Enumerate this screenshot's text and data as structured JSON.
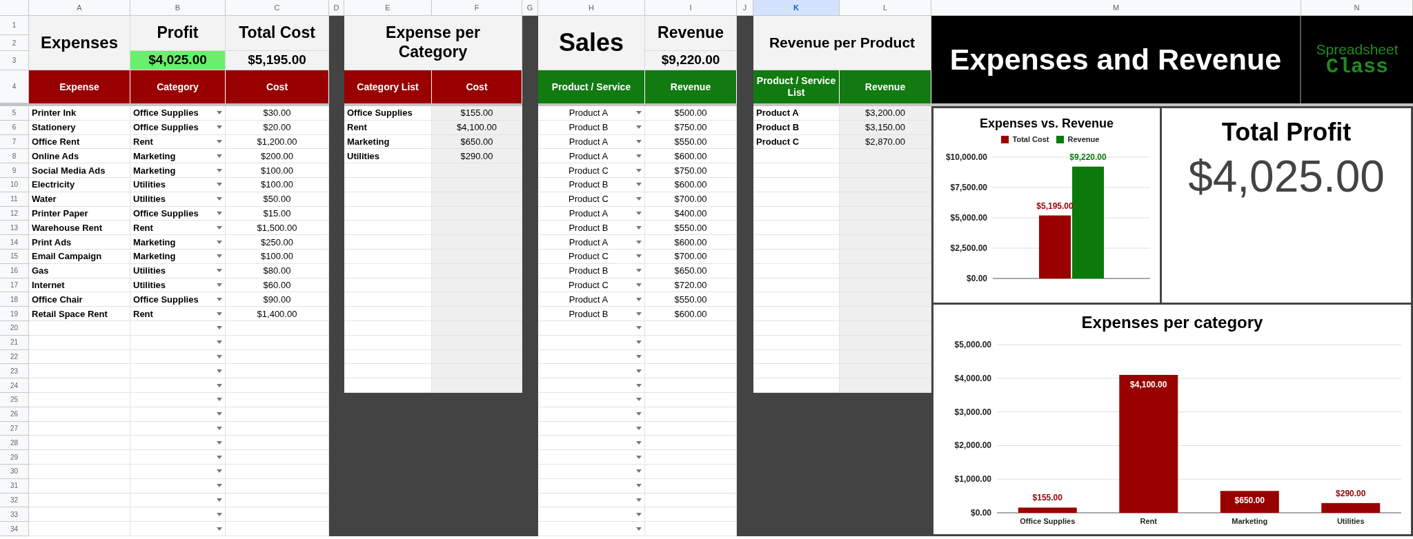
{
  "column_headers": [
    {
      "label": "A",
      "selected": false
    },
    {
      "label": "B",
      "selected": false
    },
    {
      "label": "C",
      "selected": false
    },
    {
      "label": "D",
      "selected": false
    },
    {
      "label": "E",
      "selected": false
    },
    {
      "label": "F",
      "selected": false
    },
    {
      "label": "G",
      "selected": false
    },
    {
      "label": "H",
      "selected": false
    },
    {
      "label": "I",
      "selected": false
    },
    {
      "label": "J",
      "selected": false
    },
    {
      "label": "K",
      "selected": true
    },
    {
      "label": "L",
      "selected": false
    },
    {
      "label": "M",
      "selected": false
    },
    {
      "label": "N",
      "selected": false
    }
  ],
  "row_numbers": [
    "1",
    "2",
    "3",
    "4",
    "5",
    "6",
    "7",
    "8",
    "9",
    "10",
    "11",
    "12",
    "13",
    "14",
    "15",
    "16",
    "17",
    "18",
    "19",
    "20",
    "21",
    "22",
    "23",
    "24",
    "25",
    "26",
    "27",
    "28",
    "29",
    "30",
    "31",
    "32",
    "33",
    "34"
  ],
  "expenses": {
    "title": "Expenses",
    "profit_label": "Profit",
    "profit_value": "$4,025.00",
    "total_cost_label": "Total Cost",
    "total_cost_value": "$5,195.00",
    "columns": [
      "Expense",
      "Category",
      "Cost"
    ],
    "rows": [
      {
        "expense": "Printer Ink",
        "category": "Office Supplies",
        "cost": "$30.00"
      },
      {
        "expense": "Stationery",
        "category": "Office Supplies",
        "cost": "$20.00"
      },
      {
        "expense": "Office Rent",
        "category": "Rent",
        "cost": "$1,200.00"
      },
      {
        "expense": "Online Ads",
        "category": "Marketing",
        "cost": "$200.00"
      },
      {
        "expense": "Social Media Ads",
        "category": "Marketing",
        "cost": "$100.00"
      },
      {
        "expense": "Electricity",
        "category": "Utilities",
        "cost": "$100.00"
      },
      {
        "expense": "Water",
        "category": "Utilities",
        "cost": "$50.00"
      },
      {
        "expense": "Printer Paper",
        "category": "Office Supplies",
        "cost": "$15.00"
      },
      {
        "expense": "Warehouse Rent",
        "category": "Rent",
        "cost": "$1,500.00"
      },
      {
        "expense": "Print Ads",
        "category": "Marketing",
        "cost": "$250.00"
      },
      {
        "expense": "Email Campaign",
        "category": "Marketing",
        "cost": "$100.00"
      },
      {
        "expense": "Gas",
        "category": "Utilities",
        "cost": "$80.00"
      },
      {
        "expense": "Internet",
        "category": "Utilities",
        "cost": "$60.00"
      },
      {
        "expense": "Office Chair",
        "category": "Office Supplies",
        "cost": "$90.00"
      },
      {
        "expense": "Retail Space Rent",
        "category": "Rent",
        "cost": "$1,400.00"
      }
    ]
  },
  "expense_per_category": {
    "title": "Expense per Category",
    "columns": [
      "Category List",
      "Cost"
    ],
    "rows": [
      {
        "category": "Office Supplies",
        "cost": "$155.00"
      },
      {
        "category": "Rent",
        "cost": "$4,100.00"
      },
      {
        "category": "Marketing",
        "cost": "$650.00"
      },
      {
        "category": "Utilities",
        "cost": "$290.00"
      }
    ]
  },
  "sales": {
    "title": "Sales",
    "revenue_label": "Revenue",
    "revenue_value": "$9,220.00",
    "columns": [
      "Product / Service",
      "Revenue"
    ],
    "rows": [
      {
        "product": "Product A",
        "revenue": "$500.00"
      },
      {
        "product": "Product B",
        "revenue": "$750.00"
      },
      {
        "product": "Product A",
        "revenue": "$550.00"
      },
      {
        "product": "Product A",
        "revenue": "$600.00"
      },
      {
        "product": "Product C",
        "revenue": "$750.00"
      },
      {
        "product": "Product B",
        "revenue": "$600.00"
      },
      {
        "product": "Product C",
        "revenue": "$700.00"
      },
      {
        "product": "Product A",
        "revenue": "$400.00"
      },
      {
        "product": "Product B",
        "revenue": "$550.00"
      },
      {
        "product": "Product A",
        "revenue": "$600.00"
      },
      {
        "product": "Product C",
        "revenue": "$700.00"
      },
      {
        "product": "Product B",
        "revenue": "$650.00"
      },
      {
        "product": "Product C",
        "revenue": "$720.00"
      },
      {
        "product": "Product A",
        "revenue": "$550.00"
      },
      {
        "product": "Product B",
        "revenue": "$600.00"
      }
    ]
  },
  "revenue_per_product": {
    "title": "Revenue per Product",
    "columns": [
      "Product / Service List",
      "Revenue"
    ],
    "rows": [
      {
        "product": "Product A",
        "revenue": "$3,200.00"
      },
      {
        "product": "Product B",
        "revenue": "$3,150.00"
      },
      {
        "product": "Product C",
        "revenue": "$2,870.00"
      }
    ]
  },
  "banner": {
    "title": "Expenses and Revenue"
  },
  "logo": {
    "line_1": "Spreadsheet",
    "line_2": "Class"
  },
  "dashboard": {
    "expenses_vs_revenue": {
      "chart_data": {
        "type": "bar",
        "title": "Expenses vs. Revenue",
        "legend": true,
        "series": [
          {
            "name": "Total Cost",
            "color": "#990000",
            "values": [
              5195
            ],
            "value_labels": [
              "$5,195.00"
            ]
          },
          {
            "name": "Revenue",
            "color": "#0b7a0b",
            "values": [
              9220
            ],
            "value_labels": [
              "$9,220.00"
            ]
          }
        ],
        "ylim": [
          0,
          10000
        ],
        "yticks": [
          {
            "value": 0,
            "label": "$0.00"
          },
          {
            "value": 2500,
            "label": "$2,500.00"
          },
          {
            "value": 5000,
            "label": "$5,000.00"
          },
          {
            "value": 7500,
            "label": "$7,500.00"
          },
          {
            "value": 10000,
            "label": "$10,000.00"
          }
        ],
        "grid": true,
        "data_labels": true
      }
    },
    "total_profit": {
      "title": "Total Profit",
      "value": "$4,025.00"
    },
    "expenses_per_category": {
      "chart_data": {
        "type": "bar",
        "title": "Expenses per category",
        "categories": [
          "Office Supplies",
          "Rent",
          "Marketing",
          "Utilities"
        ],
        "series": [
          {
            "color": "#990000",
            "values": [
              155,
              4100,
              650,
              290
            ],
            "value_labels": [
              "$155.00",
              "$4,100.00",
              "$650.00",
              "$290.00"
            ]
          }
        ],
        "ylim": [
          0,
          5000
        ],
        "yticks": [
          {
            "value": 0,
            "label": "$0.00"
          },
          {
            "value": 1000,
            "label": "$1,000.00"
          },
          {
            "value": 2000,
            "label": "$2,000.00"
          },
          {
            "value": 3000,
            "label": "$3,000.00"
          },
          {
            "value": 4000,
            "label": "$4,000.00"
          },
          {
            "value": 5000,
            "label": "$5,000.00"
          }
        ],
        "grid": true,
        "data_labels": true
      }
    }
  }
}
